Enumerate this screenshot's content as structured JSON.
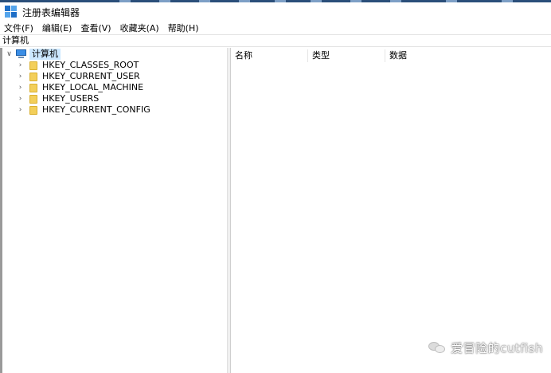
{
  "window": {
    "title": "注册表编辑器",
    "app_icon": "regedit-icon"
  },
  "menu": [
    {
      "label": "文件(F)"
    },
    {
      "label": "编辑(E)"
    },
    {
      "label": "查看(V)"
    },
    {
      "label": "收藏夹(A)"
    },
    {
      "label": "帮助(H)"
    }
  ],
  "address": {
    "path": "计算机"
  },
  "tree": {
    "root": {
      "label": "计算机",
      "expanded": true,
      "selected": true,
      "icon": "computer-icon"
    },
    "hives": [
      {
        "label": "HKEY_CLASSES_ROOT",
        "icon": "folder-icon"
      },
      {
        "label": "HKEY_CURRENT_USER",
        "icon": "folder-icon"
      },
      {
        "label": "HKEY_LOCAL_MACHINE",
        "icon": "folder-icon"
      },
      {
        "label": "HKEY_USERS",
        "icon": "folder-icon"
      },
      {
        "label": "HKEY_CURRENT_CONFIG",
        "icon": "folder-icon"
      }
    ]
  },
  "list": {
    "columns": [
      {
        "label": "名称"
      },
      {
        "label": "类型"
      },
      {
        "label": "数据"
      }
    ]
  },
  "watermark": {
    "text": "爱冒险的cutfish",
    "icon": "wechat-icon"
  },
  "colors": {
    "selection": "#cce8ff",
    "folder": "#f3cf5a",
    "accent": "#1f6fc7"
  }
}
